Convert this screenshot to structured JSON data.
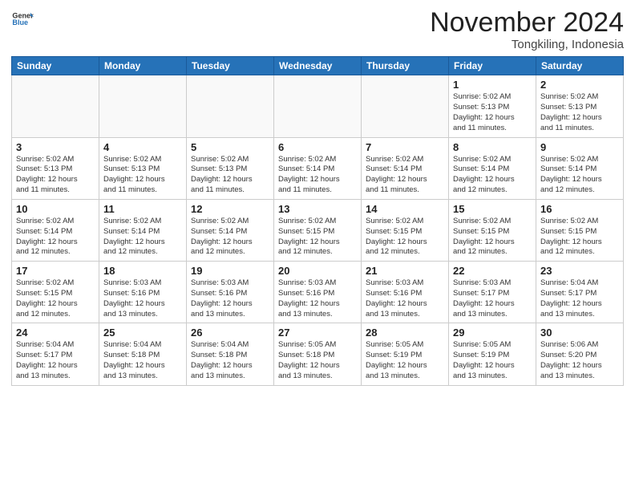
{
  "header": {
    "logo_general": "General",
    "logo_blue": "Blue",
    "month": "November 2024",
    "location": "Tongkiling, Indonesia"
  },
  "weekdays": [
    "Sunday",
    "Monday",
    "Tuesday",
    "Wednesday",
    "Thursday",
    "Friday",
    "Saturday"
  ],
  "weeks": [
    [
      {
        "day": "",
        "info": ""
      },
      {
        "day": "",
        "info": ""
      },
      {
        "day": "",
        "info": ""
      },
      {
        "day": "",
        "info": ""
      },
      {
        "day": "",
        "info": ""
      },
      {
        "day": "1",
        "info": "Sunrise: 5:02 AM\nSunset: 5:13 PM\nDaylight: 12 hours\nand 11 minutes."
      },
      {
        "day": "2",
        "info": "Sunrise: 5:02 AM\nSunset: 5:13 PM\nDaylight: 12 hours\nand 11 minutes."
      }
    ],
    [
      {
        "day": "3",
        "info": "Sunrise: 5:02 AM\nSunset: 5:13 PM\nDaylight: 12 hours\nand 11 minutes."
      },
      {
        "day": "4",
        "info": "Sunrise: 5:02 AM\nSunset: 5:13 PM\nDaylight: 12 hours\nand 11 minutes."
      },
      {
        "day": "5",
        "info": "Sunrise: 5:02 AM\nSunset: 5:13 PM\nDaylight: 12 hours\nand 11 minutes."
      },
      {
        "day": "6",
        "info": "Sunrise: 5:02 AM\nSunset: 5:14 PM\nDaylight: 12 hours\nand 11 minutes."
      },
      {
        "day": "7",
        "info": "Sunrise: 5:02 AM\nSunset: 5:14 PM\nDaylight: 12 hours\nand 11 minutes."
      },
      {
        "day": "8",
        "info": "Sunrise: 5:02 AM\nSunset: 5:14 PM\nDaylight: 12 hours\nand 12 minutes."
      },
      {
        "day": "9",
        "info": "Sunrise: 5:02 AM\nSunset: 5:14 PM\nDaylight: 12 hours\nand 12 minutes."
      }
    ],
    [
      {
        "day": "10",
        "info": "Sunrise: 5:02 AM\nSunset: 5:14 PM\nDaylight: 12 hours\nand 12 minutes."
      },
      {
        "day": "11",
        "info": "Sunrise: 5:02 AM\nSunset: 5:14 PM\nDaylight: 12 hours\nand 12 minutes."
      },
      {
        "day": "12",
        "info": "Sunrise: 5:02 AM\nSunset: 5:14 PM\nDaylight: 12 hours\nand 12 minutes."
      },
      {
        "day": "13",
        "info": "Sunrise: 5:02 AM\nSunset: 5:15 PM\nDaylight: 12 hours\nand 12 minutes."
      },
      {
        "day": "14",
        "info": "Sunrise: 5:02 AM\nSunset: 5:15 PM\nDaylight: 12 hours\nand 12 minutes."
      },
      {
        "day": "15",
        "info": "Sunrise: 5:02 AM\nSunset: 5:15 PM\nDaylight: 12 hours\nand 12 minutes."
      },
      {
        "day": "16",
        "info": "Sunrise: 5:02 AM\nSunset: 5:15 PM\nDaylight: 12 hours\nand 12 minutes."
      }
    ],
    [
      {
        "day": "17",
        "info": "Sunrise: 5:02 AM\nSunset: 5:15 PM\nDaylight: 12 hours\nand 12 minutes."
      },
      {
        "day": "18",
        "info": "Sunrise: 5:03 AM\nSunset: 5:16 PM\nDaylight: 12 hours\nand 13 minutes."
      },
      {
        "day": "19",
        "info": "Sunrise: 5:03 AM\nSunset: 5:16 PM\nDaylight: 12 hours\nand 13 minutes."
      },
      {
        "day": "20",
        "info": "Sunrise: 5:03 AM\nSunset: 5:16 PM\nDaylight: 12 hours\nand 13 minutes."
      },
      {
        "day": "21",
        "info": "Sunrise: 5:03 AM\nSunset: 5:16 PM\nDaylight: 12 hours\nand 13 minutes."
      },
      {
        "day": "22",
        "info": "Sunrise: 5:03 AM\nSunset: 5:17 PM\nDaylight: 12 hours\nand 13 minutes."
      },
      {
        "day": "23",
        "info": "Sunrise: 5:04 AM\nSunset: 5:17 PM\nDaylight: 12 hours\nand 13 minutes."
      }
    ],
    [
      {
        "day": "24",
        "info": "Sunrise: 5:04 AM\nSunset: 5:17 PM\nDaylight: 12 hours\nand 13 minutes."
      },
      {
        "day": "25",
        "info": "Sunrise: 5:04 AM\nSunset: 5:18 PM\nDaylight: 12 hours\nand 13 minutes."
      },
      {
        "day": "26",
        "info": "Sunrise: 5:04 AM\nSunset: 5:18 PM\nDaylight: 12 hours\nand 13 minutes."
      },
      {
        "day": "27",
        "info": "Sunrise: 5:05 AM\nSunset: 5:18 PM\nDaylight: 12 hours\nand 13 minutes."
      },
      {
        "day": "28",
        "info": "Sunrise: 5:05 AM\nSunset: 5:19 PM\nDaylight: 12 hours\nand 13 minutes."
      },
      {
        "day": "29",
        "info": "Sunrise: 5:05 AM\nSunset: 5:19 PM\nDaylight: 12 hours\nand 13 minutes."
      },
      {
        "day": "30",
        "info": "Sunrise: 5:06 AM\nSunset: 5:20 PM\nDaylight: 12 hours\nand 13 minutes."
      }
    ]
  ]
}
